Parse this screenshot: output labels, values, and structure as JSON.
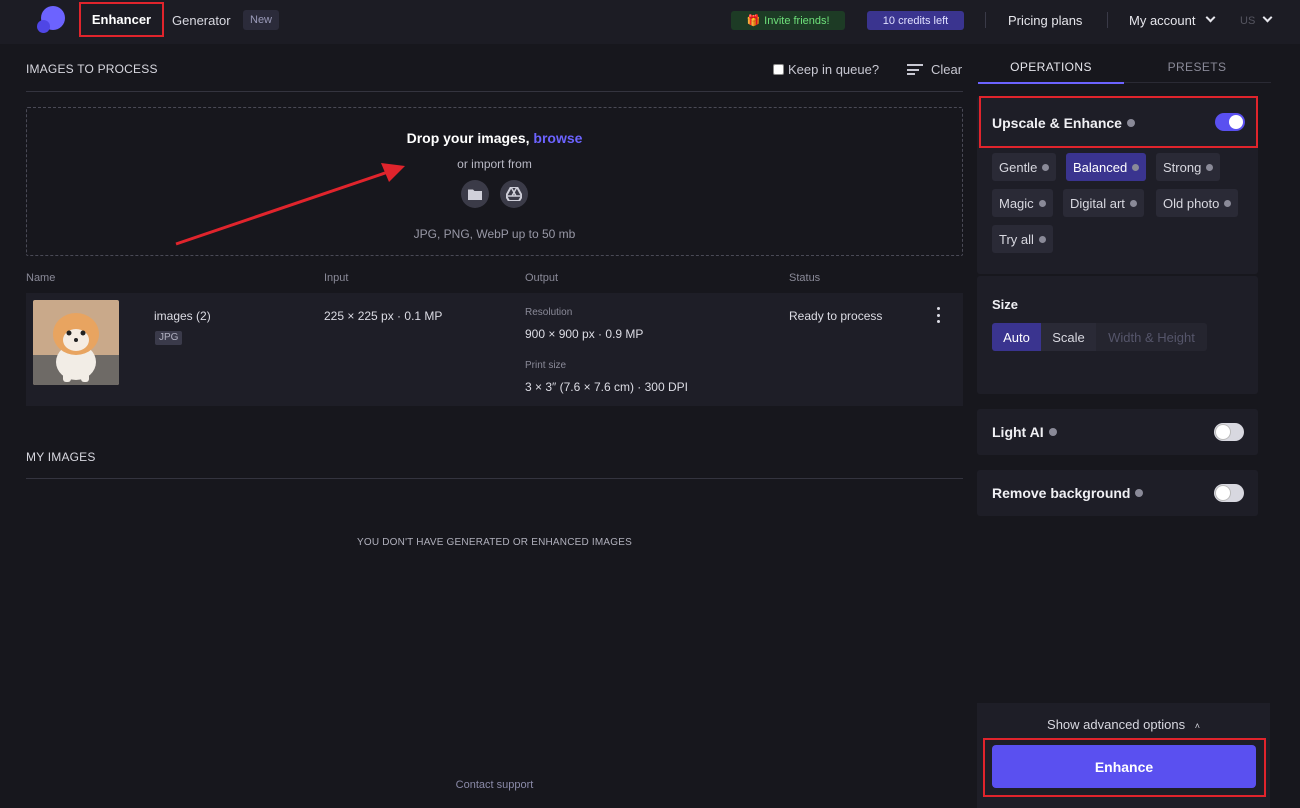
{
  "header": {
    "nav_enhancer": "Enhancer",
    "nav_generator": "Generator",
    "new_badge": "New",
    "invite": "Invite friends!",
    "credits": "10 credits left",
    "pricing": "Pricing plans",
    "account": "My account",
    "lang": "US"
  },
  "queue": {
    "title": "IMAGES TO PROCESS",
    "keep_in_queue": "Keep in queue?",
    "clear": "Clear",
    "drop_text": "Drop your images, ",
    "browse": "browse",
    "import_from": "or import from",
    "formats": "JPG, PNG, WebP up to 50 mb",
    "columns": {
      "name": "Name",
      "input": "Input",
      "output": "Output",
      "status": "Status"
    },
    "row": {
      "filename": "images (2)",
      "type": "JPG",
      "input": "225 × 225 px · 0.1 MP",
      "resolution_label": "Resolution",
      "resolution": "900 × 900 px · 0.9 MP",
      "print_label": "Print size",
      "print": "3 × 3″ (7.6 × 7.6 cm) · 300 DPI",
      "status": "Ready to process"
    }
  },
  "my_images": {
    "title": "MY IMAGES",
    "empty": "YOU DON'T HAVE GENERATED OR ENHANCED IMAGES"
  },
  "footer": {
    "support": "Contact support"
  },
  "panel": {
    "tab_operations": "OPERATIONS",
    "tab_presets": "PRESETS",
    "upscale_title": "Upscale & Enhance",
    "upscale_on": true,
    "modes": [
      "Gentle",
      "Balanced",
      "Strong",
      "Magic",
      "Digital art",
      "Old photo",
      "Try all"
    ],
    "active_mode": "Balanced",
    "size_title": "Size",
    "size_options": [
      "Auto",
      "Scale",
      "Width & Height"
    ],
    "active_size": "Auto",
    "light_ai": "Light AI",
    "light_ai_on": false,
    "remove_bg": "Remove background",
    "remove_bg_on": false,
    "show_advanced": "Show advanced options",
    "enhance_button": "Enhance"
  },
  "colors": {
    "accent": "#6c63ff",
    "button": "#5a50f0",
    "highlight": "#e0242c",
    "invite": "#6ee07a"
  }
}
